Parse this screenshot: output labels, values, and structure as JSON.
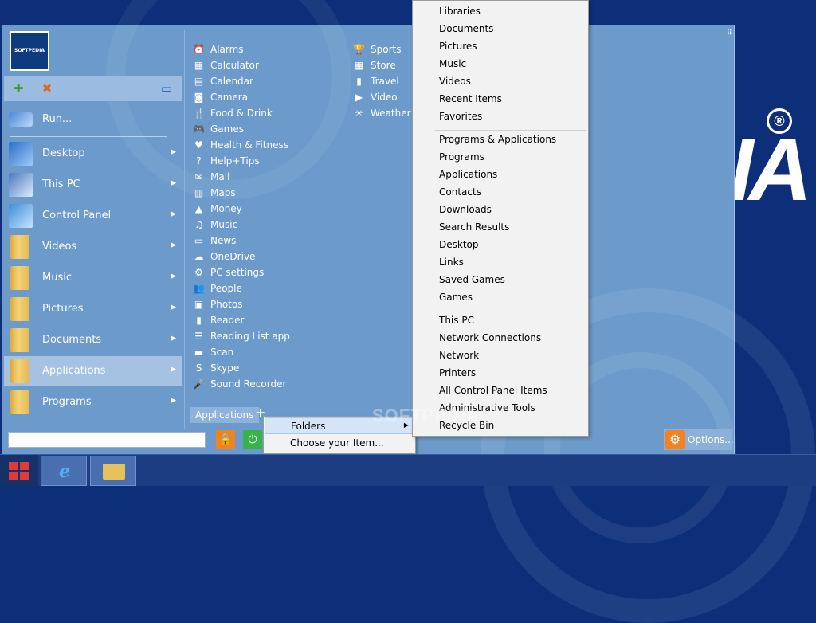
{
  "brand": {
    "text": "IA",
    "reg": "®"
  },
  "startmenu": {
    "logo_text": "SOFTPEDIA",
    "run_label": "Run...",
    "left_items": [
      {
        "label": "Desktop",
        "icon": "desktop-icon"
      },
      {
        "label": "This PC",
        "icon": "computer-icon"
      },
      {
        "label": "Control Panel",
        "icon": "control-panel-icon"
      },
      {
        "label": "Videos",
        "icon": "folder-icon"
      },
      {
        "label": "Music",
        "icon": "folder-icon"
      },
      {
        "label": "Pictures",
        "icon": "folder-icon"
      },
      {
        "label": "Documents",
        "icon": "folder-icon"
      },
      {
        "label": "Applications",
        "icon": "folder-icon"
      },
      {
        "label": "Programs",
        "icon": "folder-icon"
      }
    ],
    "apps_col1": [
      {
        "label": "Alarms",
        "icon": "⏰"
      },
      {
        "label": "Calculator",
        "icon": "▦"
      },
      {
        "label": "Calendar",
        "icon": "▤"
      },
      {
        "label": "Camera",
        "icon": "◙"
      },
      {
        "label": "Food & Drink",
        "icon": "🍴"
      },
      {
        "label": "Games",
        "icon": "🎮"
      },
      {
        "label": "Health & Fitness",
        "icon": "♥"
      },
      {
        "label": "Help+Tips",
        "icon": "?"
      },
      {
        "label": "Mail",
        "icon": "✉"
      },
      {
        "label": "Maps",
        "icon": "▥"
      },
      {
        "label": "Money",
        "icon": "▲"
      },
      {
        "label": "Music",
        "icon": "♫"
      },
      {
        "label": "News",
        "icon": "▭"
      },
      {
        "label": "OneDrive",
        "icon": "☁"
      },
      {
        "label": "PC settings",
        "icon": "⚙"
      },
      {
        "label": "People",
        "icon": "👥"
      },
      {
        "label": "Photos",
        "icon": "▣"
      },
      {
        "label": "Reader",
        "icon": "▮"
      },
      {
        "label": "Reading List app",
        "icon": "☰"
      },
      {
        "label": "Scan",
        "icon": "▬"
      },
      {
        "label": "Skype",
        "icon": "S"
      },
      {
        "label": "Sound Recorder",
        "icon": "🎤"
      }
    ],
    "apps_col2": [
      {
        "label": "Sports",
        "icon": "🏆"
      },
      {
        "label": "Store",
        "icon": "▦"
      },
      {
        "label": "Travel",
        "icon": "▮"
      },
      {
        "label": "Video",
        "icon": "▶"
      },
      {
        "label": "Weather",
        "icon": "☀"
      }
    ],
    "apps_tab_label": "Applications",
    "add_symbol": "+",
    "options_label": "Options...",
    "search_value": ""
  },
  "popup": {
    "items": [
      {
        "label": "Folders",
        "has_arrow": true
      },
      {
        "label": "Choose your Item...",
        "has_arrow": false
      }
    ]
  },
  "submenu": {
    "items": [
      "Libraries",
      "Documents",
      "Pictures",
      "Music",
      "Videos",
      "Recent Items",
      "Favorites",
      "Programs & Applications",
      "Programs",
      "Applications",
      "Contacts",
      "Downloads",
      "Search Results",
      "Desktop",
      "Links",
      "Saved Games",
      "Games",
      "This PC",
      "Network Connections",
      "Network",
      "Printers",
      "All Control Panel Items",
      "Administrative Tools",
      "Recycle Bin"
    ]
  },
  "watermark": "SOFTPEDIA",
  "colors": {
    "desktop_bg": "#0d2f7a",
    "menu_bg": "#6c9bcb",
    "accent_orange": "#f2811e",
    "accent_green": "#38b34a"
  }
}
